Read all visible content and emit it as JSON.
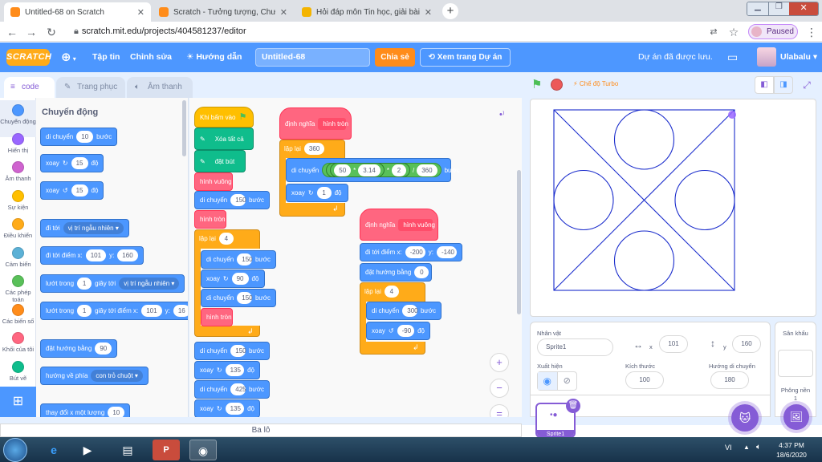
{
  "browser": {
    "tabs": [
      {
        "title": "Untitled-68 on Scratch",
        "color": "#ff8c1a"
      },
      {
        "title": "Scratch - Tưởng tượng, Chương t",
        "color": "#ff8c1a"
      },
      {
        "title": "Hỏi đáp môn Tin học, giải bài tập",
        "color": "#f4b400"
      }
    ],
    "url": "scratch.mit.edu/projects/404581237/editor",
    "paused_label": "Paused"
  },
  "menu": {
    "logo": "SCRATCH",
    "file": "Tập tin",
    "edit": "Chỉnh sửa",
    "tutorials": "Hướng dẫn",
    "project_title": "Untitled-68",
    "share": "Chia sẻ",
    "see_project": "Xem trang Dự án",
    "saved_status": "Dự án đã được lưu.",
    "username": "Ulabalu"
  },
  "editor_tabs": {
    "code": "code",
    "costumes": "Trang phục",
    "sounds": "Âm thanh"
  },
  "categories": [
    {
      "label": "Chuyển động",
      "color": "#4c97ff"
    },
    {
      "label": "Hiển thị",
      "color": "#9966ff"
    },
    {
      "label": "Âm thanh",
      "color": "#cf63cf"
    },
    {
      "label": "Sự kiện",
      "color": "#ffbf00"
    },
    {
      "label": "Điều khiển",
      "color": "#ffab19"
    },
    {
      "label": "Cảm biến",
      "color": "#5cb1d6"
    },
    {
      "label": "Các phép toán",
      "color": "#59c059"
    },
    {
      "label": "Các biến số",
      "color": "#ff8c1a"
    },
    {
      "label": "Khối của tôi",
      "color": "#ff6680"
    },
    {
      "label": "Bút vẽ",
      "color": "#0fbd8c"
    }
  ],
  "palette": {
    "heading": "Chuyển động",
    "move": "di chuyển",
    "move_val": "10",
    "steps": "bước",
    "turn_right": "xoay",
    "turn_right_val": "15",
    "deg": "độ",
    "turn_left": "xoay",
    "turn_left_val": "15",
    "goto": "đi tới",
    "goto_dd": "vị trí ngẫu nhiên",
    "goto_xy": "đi tới điểm x:",
    "goto_x": "101",
    "y": "y:",
    "goto_y": "160",
    "glide": "lướt trong",
    "glide_val": "1",
    "glide_sec": "giây tới",
    "glide_dd": "vị trí ngẫu nhiên",
    "glide_xy": "lướt trong",
    "glide_xy_val": "1",
    "glide_xy_sec": "giây tới điểm x:",
    "glide_xy_x": "101",
    "glide_xy_y": "16",
    "point_dir": "đặt hướng bằng",
    "point_dir_val": "90",
    "point_towards": "hướng về phía",
    "point_towards_dd": "con trỏ chuột",
    "change_x": "thay đổi x một lượng",
    "change_x_val": "10"
  },
  "script1": {
    "hat": "Khi bấm vào",
    "clear": "Xóa tất cả",
    "pendown": "đặt bút",
    "c1": "hình vuông",
    "m1": "di chuyển",
    "m1v": "150",
    "steps": "bước",
    "c2": "hình tròn",
    "rep": "lặp lại",
    "repv": "4",
    "r1": "di chuyển",
    "r1v": "150",
    "r2": "xoay",
    "r2v": "90",
    "deg": "độ",
    "r3": "di chuyển",
    "r3v": "150",
    "r4": "hình tròn",
    "m2": "di chuyển",
    "m2v": "150",
    "t2": "xoay",
    "t2v": "135",
    "m3": "di chuyển",
    "m3v": "425",
    "t3": "xoay",
    "t3v": "135"
  },
  "script2": {
    "define": "định nghĩa",
    "name": "hình tròn",
    "rep": "lặp lại",
    "repv": "360",
    "move": "di chuyển",
    "a": "50",
    "b": "3.14",
    "c": "2",
    "d": "360",
    "mul": "*",
    "div": "/",
    "steps": "bước",
    "turn": "xoay",
    "turnv": "1",
    "deg": "độ"
  },
  "script3": {
    "define": "định nghĩa",
    "name": "hình vuông",
    "goto": "đi tới điểm x:",
    "x": "-200",
    "y": "y:",
    "yv": "-140",
    "dir": "đặt hướng bằng",
    "dirv": "0",
    "rep": "lặp lại",
    "repv": "4",
    "move": "di chuyển",
    "movev": "300",
    "steps": "bước",
    "turn": "xoay",
    "turnv": "-90",
    "deg": "độ"
  },
  "stage": {
    "turbo": "Chế độ Turbo",
    "stroke_color": "#1a2ccc"
  },
  "sprite": {
    "label": "Nhân vật",
    "name": "Sprite1",
    "x_label": "x",
    "x": "101",
    "y_label": "y",
    "y": "160",
    "show_label": "Xuất hiện",
    "size_label": "Kích thước",
    "size": "100",
    "dir_label": "Hướng di chuyển",
    "dir": "180",
    "thumb_name": "Sprite1"
  },
  "stage_panel": {
    "title": "Sân khấu",
    "backdrops": "Phông nền",
    "count": "1"
  },
  "backpack": "Ba lô",
  "taskbar": {
    "lang": "VI",
    "time": "4:37 PM",
    "date": "18/6/2020"
  }
}
